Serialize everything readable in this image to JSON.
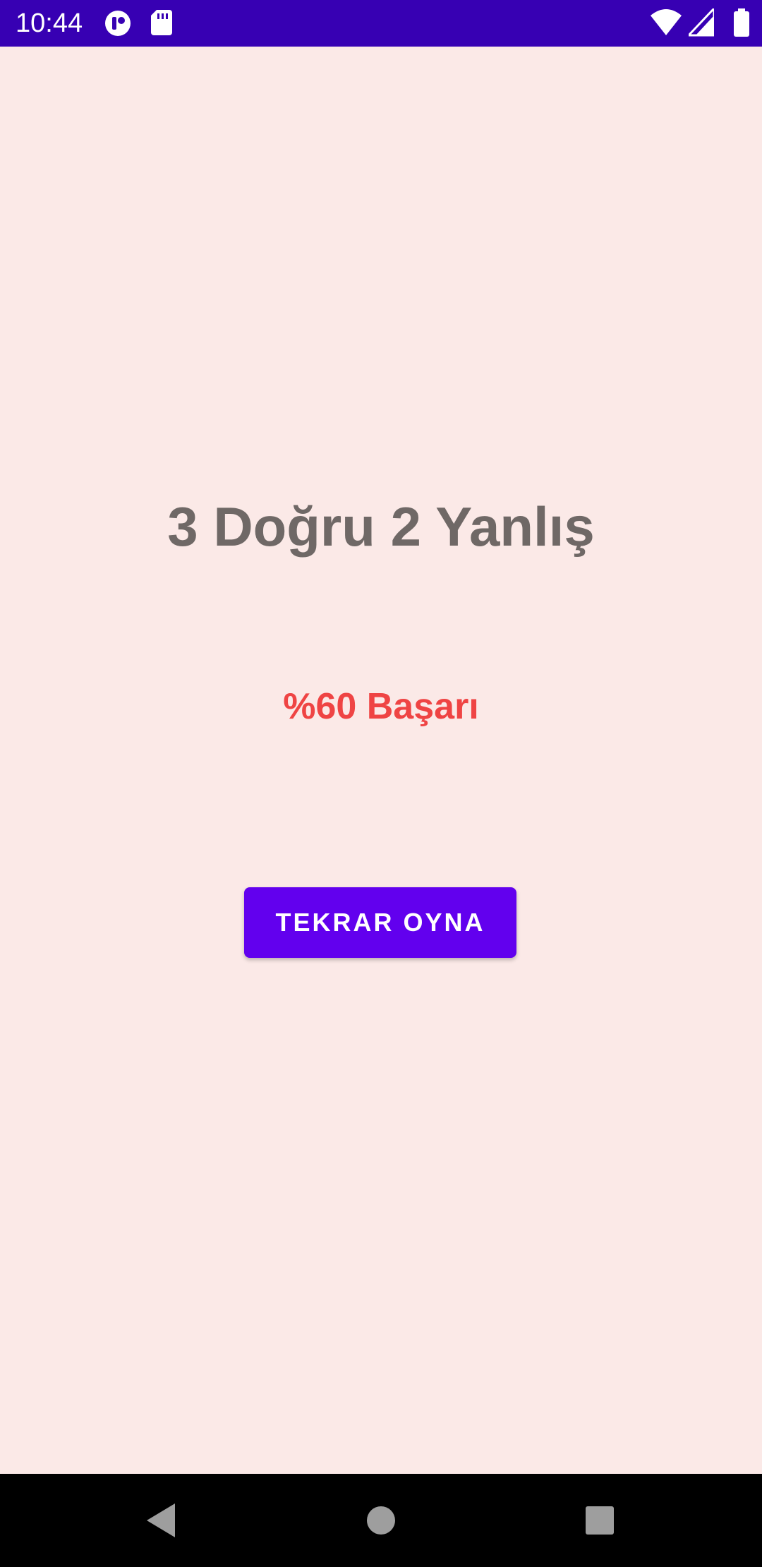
{
  "status_bar": {
    "time": "10:44",
    "background": "#3700b3",
    "left_icons": [
      "notification-app-icon",
      "sd-card-icon"
    ],
    "right_icons": [
      "wifi-icon",
      "cell-signal-icon",
      "battery-icon"
    ]
  },
  "result": {
    "score_text": "3 Doğru 2 Yanlış",
    "success_text": "%60 Başarı",
    "score_color": "#6f6866",
    "success_color": "#ef4444"
  },
  "actions": {
    "replay_label": "TEKRAR OYNA",
    "button_color": "#6200ee"
  },
  "nav_bar": {
    "buttons": [
      "back-icon",
      "home-icon",
      "recents-icon"
    ]
  },
  "background_color": "#fbe9e7"
}
